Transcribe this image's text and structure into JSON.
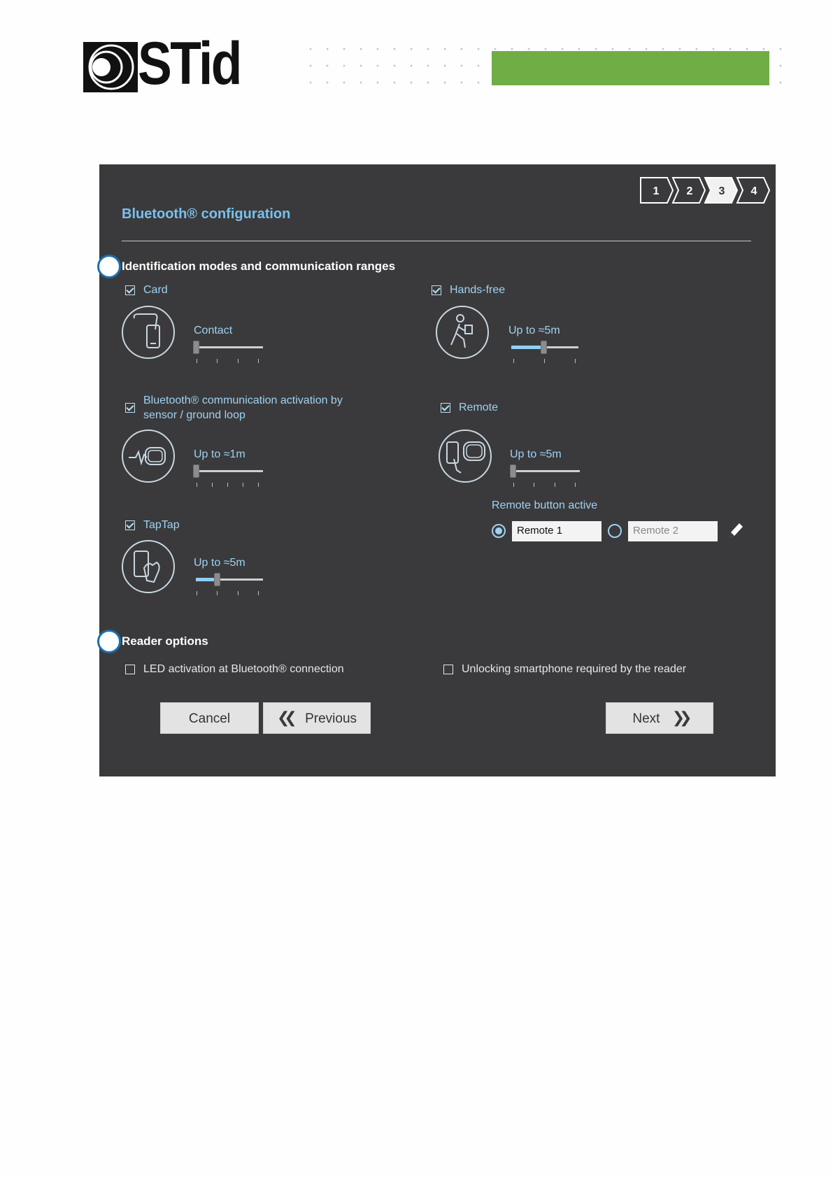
{
  "brand": {
    "logo_text": "STid",
    "accent_bar_color": "#6fae45"
  },
  "wizard": {
    "title": "Bluetooth® configuration",
    "steps": [
      "1",
      "2",
      "3",
      "4"
    ],
    "active_step": "3",
    "section_ident": "Identification modes and communication ranges",
    "section_options": "Reader options",
    "modes": {
      "card": {
        "label": "Card",
        "checked": true,
        "range": "Contact",
        "icon": "card-phone-icon",
        "level": 0
      },
      "handsfree": {
        "label": "Hands-free",
        "checked": true,
        "range": "Up to ≈5m",
        "icon": "walking-person-icon",
        "level": 0.5
      },
      "sensor": {
        "label_line1": "Bluetooth® communication activation by",
        "label_line2": "sensor / ground loop",
        "checked": true,
        "range": "Up to ≈1m",
        "icon": "sensor-wave-icon",
        "level": 0
      },
      "remote": {
        "label": "Remote",
        "checked": true,
        "range": "Up to ≈5m",
        "icon": "remote-phone-icon",
        "level": 0
      },
      "taptap": {
        "label": "TapTap",
        "checked": true,
        "range": "Up to ≈5m",
        "icon": "hand-tap-icon",
        "level": 0.33
      }
    },
    "remote_button": {
      "label": "Remote button active",
      "remote1": "Remote 1",
      "remote2": "Remote 2",
      "selected": "Remote 1"
    },
    "options": {
      "led": {
        "label": "LED activation at Bluetooth® connection",
        "checked": false
      },
      "unlock": {
        "label": "Unlocking smartphone required by the reader",
        "checked": false
      }
    },
    "buttons": {
      "cancel": "Cancel",
      "previous": "Previous",
      "next": "Next"
    }
  }
}
